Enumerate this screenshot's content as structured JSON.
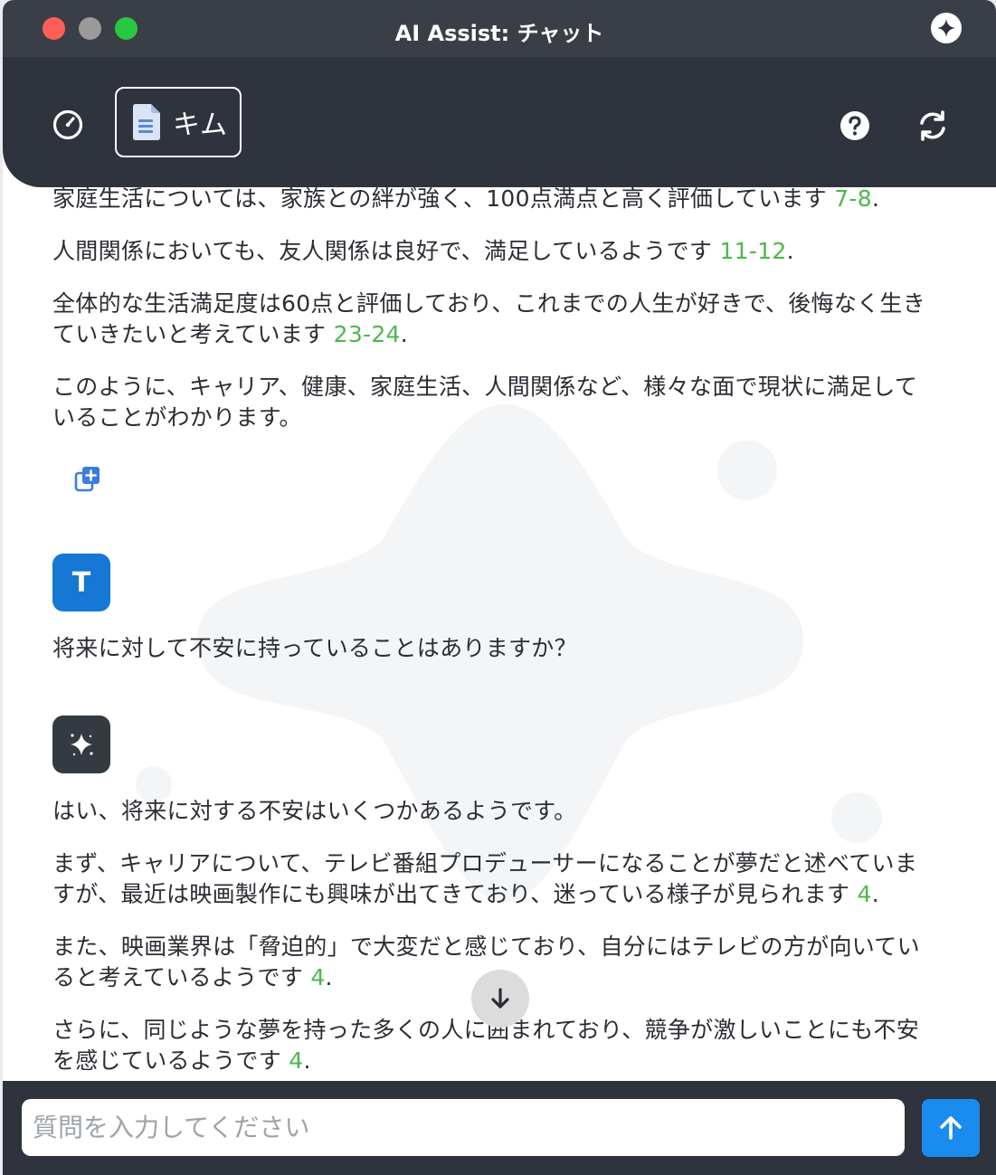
{
  "window": {
    "title": "AI Assist: チャット"
  },
  "toolbar": {
    "document_chip_label": "キム",
    "icons": [
      "dashboard-icon",
      "document-icon",
      "help-icon",
      "refresh-icon"
    ]
  },
  "chat": {
    "messages": [
      {
        "role": "assistant",
        "paragraphs": [
          {
            "text": "家庭生活については、家族との絆が強く、100点満点と高く評価しています ",
            "cite": "7-8",
            "end": "."
          },
          {
            "text": "人間関係においても、友人関係は良好で、満足しているようです ",
            "cite": "11-12",
            "end": "."
          },
          {
            "line1": "全体的な生活満足度は60点と評価しており、これまでの人生が好きで、後悔なく生き",
            "line2": "ていきたいと考えています ",
            "cite": "23-24",
            "end": "."
          },
          {
            "line1": "このように、キャリア、健康、家庭生活、人間関係など、様々な面で現状に満足して",
            "line2": "いることがわかります。"
          }
        ]
      },
      {
        "role": "user",
        "avatar_letter": "T",
        "text": "将来に対して不安に持っていることはありますか？"
      },
      {
        "role": "assistant",
        "paragraphs": [
          {
            "text": "はい、将来に対する不安はいくつかあるようです。"
          },
          {
            "line1": "まず、キャリアについて、テレビ番組プロデューサーになることが夢だと述べていま",
            "line2": "すが、最近は映画製作にも興味が出てきており、迷っている様子が見られます ",
            "cite": "4",
            "end": "."
          },
          {
            "line1": "また、映画業界は「脅迫的」で大変だと感じており、自分にはテレビの方が向いてい",
            "line2": "ると考えているようです ",
            "cite": "4",
            "end": "."
          },
          {
            "line1": "さらに、同じような夢を持った多くの人に囲まれており、競争が激しいことにも不安",
            "line2": "を感じているようです ",
            "cite": "4",
            "end": "."
          }
        ]
      }
    ]
  },
  "input": {
    "placeholder": "質問を入力してください",
    "value": ""
  },
  "colors": {
    "titlebar": "#3a3f47",
    "toolbar": "#2e333d",
    "citation": "#4cb84c",
    "user_avatar": "#1478d4",
    "send_button": "#1a8cf0"
  }
}
